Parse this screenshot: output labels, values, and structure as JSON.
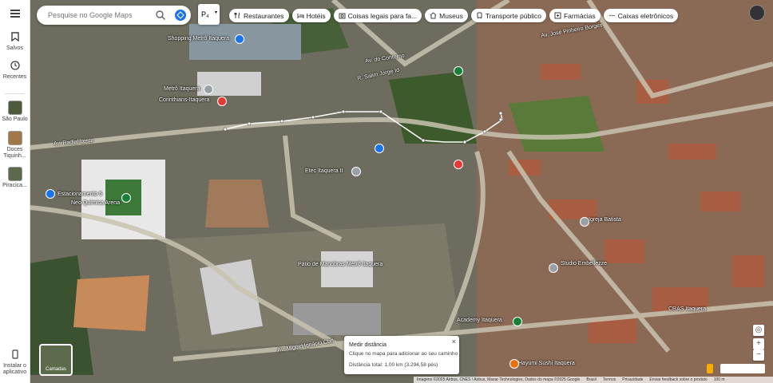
{
  "rail": {
    "saved_label": "Salvos",
    "recent_label": "Recentes",
    "places": [
      {
        "label": "São Paulo"
      },
      {
        "label": "Doces Tiquinh..."
      },
      {
        "label": "Piracica..."
      }
    ],
    "app_label": "Instalar o aplicativo"
  },
  "search": {
    "placeholder": "Pesquise no Google Maps",
    "layer_abbr": "P₄"
  },
  "chips": [
    {
      "label": "Restaurantes",
      "icon": "fork-knife-icon"
    },
    {
      "label": "Hotéis",
      "icon": "bed-icon"
    },
    {
      "label": "Coisas legais para fa...",
      "icon": "camera-icon"
    },
    {
      "label": "Museus",
      "icon": "museum-icon"
    },
    {
      "label": "Transporte público",
      "icon": "train-icon"
    },
    {
      "label": "Farmácias",
      "icon": "pharmacy-icon"
    },
    {
      "label": "Caixas eletrônicos",
      "icon": "atm-icon"
    }
  ],
  "map_labels": {
    "shopping": "Shopping Metrô Itaquera",
    "metro_itaquera": "Metrô Itaquera",
    "corinthians": "Corinthians-Itaquera",
    "estacionamento": "Estacionamento 5",
    "neo_quimica": "Neo Química Arena",
    "etec": "Etec Itaquera II",
    "patio": "Pátio de Manobras Metrô Itaquera",
    "studio": "Studio Embellezze",
    "cras": "CRAS Itaquera",
    "academy": "Academy Itaquera",
    "sushi": "Hayumi Sushi Itaquera",
    "igreja": "Igreja Batista",
    "av_contorno": "Av. do Contorno",
    "av_jose_pinheiro": "Av. José Pinheiro Borges",
    "av_miguel": "Av. Miguel Ignácio Curi",
    "r_salim": "R. Salim Jorge Id",
    "av_radial": "Av. Radial Leste"
  },
  "measure": {
    "title": "Medir distância",
    "hint": "Clique no mapa para adicionar ao seu caminho",
    "total": "Distância total: 1,00 km (3.294,58 pés)"
  },
  "layers_label": "Camadas",
  "footer": {
    "imagery": "Imagens ©2025 Airbus, CNES / Airbus, Maxar Technologies, Dados do mapa ©2025 Google",
    "country": "Brasil",
    "terms": "Termos",
    "privacy": "Privacidade",
    "feedback": "Enviar feedback sobre o produto",
    "scale": "100 m"
  },
  "colors": {
    "accent": "#1a73e8",
    "measure_line": "#ffffff"
  }
}
